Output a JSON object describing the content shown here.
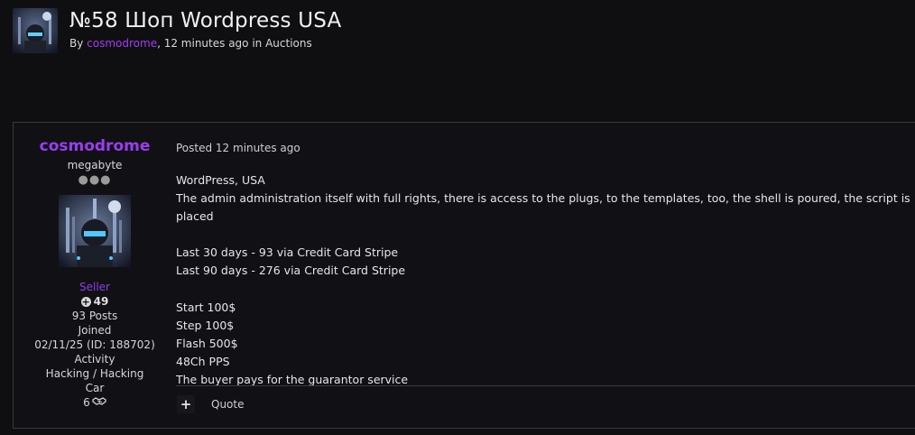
{
  "topic": {
    "title": "№58 Шоп Wordpress USA",
    "by_prefix": "By ",
    "author": "cosmodrome",
    "meta_time": ", 12 minutes ago in ",
    "forum": "Auctions"
  },
  "author_panel": {
    "name": "cosmodrome",
    "rank": "megabyte",
    "pips": "●●●",
    "group": "Seller",
    "reputation": "49",
    "posts": "93 Posts",
    "joined_label": "Joined",
    "joined_value": "02/11/25 (ID: 188702)",
    "activity_label": "Activity",
    "activity_value": "Hacking / Hacking",
    "car_label": "Car",
    "deals_count": "6",
    "deals_icon": "handshake-icon"
  },
  "post": {
    "posted": "Posted 12 minutes ago",
    "lines": [
      "WordPress, USA",
      "The admin administration itself with full rights, there is access to the plugs, to the templates, too, the shell is poured, the script is placed",
      "",
      "Last 30 days - 93 via Credit Card Stripe",
      "Last 90 days - 276 via Credit Card Stripe",
      "",
      "Start 100$",
      "Step 100$",
      "Flash 500$",
      "48Ch PPS",
      "The buyer pays for the guarantor service"
    ]
  },
  "footer": {
    "plus_label": "+",
    "quote_label": "Quote"
  },
  "colors": {
    "background": "#0f0f12",
    "accent": "#9b3df0",
    "border": "#3a3a32"
  }
}
